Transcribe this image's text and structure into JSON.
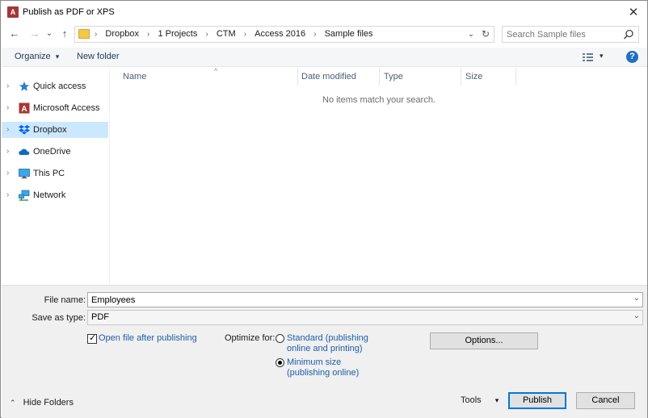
{
  "window": {
    "title": "Publish as PDF or XPS",
    "app_icon_letter": "A",
    "close_glyph": "✕"
  },
  "navigation": {
    "back_glyph": "←",
    "forward_glyph": "→",
    "recent_glyph": "⌄",
    "up_glyph": "↑"
  },
  "address": {
    "crumbs": [
      "Dropbox",
      "1 Projects",
      "CTM",
      "Access 2016",
      "Sample files"
    ],
    "separator": "›",
    "dropdown_glyph": "⌄",
    "refresh_glyph": "↻"
  },
  "search": {
    "placeholder": "Search Sample files"
  },
  "toolbar": {
    "organize_label": "Organize",
    "organize_caret": "▾",
    "new_folder_label": "New folder",
    "view_caret": "▾",
    "help_label": "?"
  },
  "sidebar": {
    "items": [
      {
        "label": "Quick access",
        "icon": "star-icon",
        "selected": false
      },
      {
        "label": "Microsoft Access",
        "icon": "access-icon",
        "selected": false
      },
      {
        "label": "Dropbox",
        "icon": "dropbox-icon",
        "selected": true
      },
      {
        "label": "OneDrive",
        "icon": "cloud-icon",
        "selected": false
      },
      {
        "label": "This PC",
        "icon": "computer-icon",
        "selected": false
      },
      {
        "label": "Network",
        "icon": "network-icon",
        "selected": false
      }
    ],
    "chevron_glyph": "›"
  },
  "filelist": {
    "columns": [
      "Name",
      "Date modified",
      "Type",
      "Size"
    ],
    "sort_glyph": "^",
    "empty_message": "No items match your search."
  },
  "form": {
    "file_name_label": "File name:",
    "file_name_value": "Employees",
    "save_as_type_label": "Save as type:",
    "save_as_type_value": "PDF",
    "open_after_publishing_label": "Open file after publishing",
    "open_after_publishing_checked": true,
    "optimize_for_label": "Optimize for:",
    "optimize_standard_line1": "Standard (publishing",
    "optimize_standard_line2": "online and printing)",
    "optimize_minimum_line1": "Minimum size",
    "optimize_minimum_line2": "(publishing online)",
    "optimize_selected": "minimum",
    "options_button": "Options...",
    "dropdown_glyph": "⌄",
    "check_glyph": "✓"
  },
  "footer": {
    "hide_folders_label": "Hide Folders",
    "hide_folders_glyph": "⌃",
    "tools_label": "Tools",
    "tools_caret": "▾",
    "publish_button": "Publish",
    "cancel_button": "Cancel"
  },
  "colors": {
    "selected_bg": "#cce8ff",
    "link": "#1e5da8",
    "help_blue": "#1f6fc5",
    "access_red": "#a4373a"
  }
}
